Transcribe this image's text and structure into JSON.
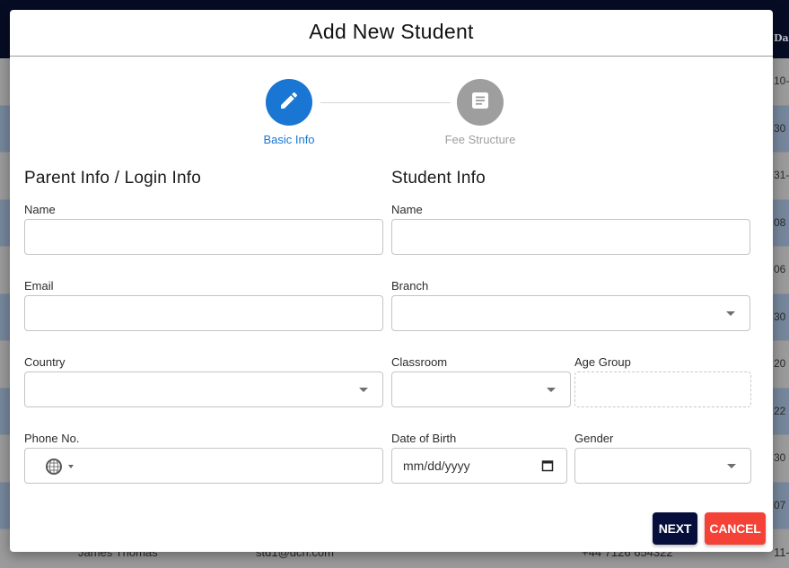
{
  "background": {
    "header_column": "Da",
    "row_dates": [
      "10-",
      "30",
      "31-",
      "08",
      "06",
      "30",
      "20",
      "22",
      "30",
      "07"
    ],
    "last_row": {
      "name": "James Thomas",
      "email": "std1@dch.com",
      "phone": "+44 7126 654322",
      "date": "11-"
    },
    "colors": {
      "header": "#060c24",
      "row_odd": "#9b9b9b",
      "row_even": "#76879d"
    }
  },
  "modal": {
    "title": "Add New Student",
    "stepper": {
      "steps": [
        {
          "label": "Basic Info",
          "icon": "pencil-icon",
          "state": "active"
        },
        {
          "label": "Fee Structure",
          "icon": "document-icon",
          "state": "inactive"
        }
      ],
      "active_color": "#1976d2",
      "inactive_color": "#9e9e9e"
    },
    "parent_section": {
      "title": "Parent Info / Login Info",
      "fields": {
        "name": {
          "label": "Name",
          "value": ""
        },
        "email": {
          "label": "Email",
          "value": ""
        },
        "country": {
          "label": "Country",
          "value": ""
        },
        "phone": {
          "label": "Phone No.",
          "value": "",
          "country_icon": "globe-icon"
        }
      }
    },
    "student_section": {
      "title": "Student Info",
      "fields": {
        "name": {
          "label": "Name",
          "value": ""
        },
        "branch": {
          "label": "Branch",
          "value": ""
        },
        "classroom": {
          "label": "Classroom",
          "value": ""
        },
        "age_group": {
          "label": "Age Group",
          "value": ""
        },
        "dob": {
          "label": "Date of Birth",
          "placeholder": "mm/dd/yyyy"
        },
        "gender": {
          "label": "Gender",
          "value": ""
        }
      }
    },
    "buttons": {
      "next": "NEXT",
      "cancel": "CANCEL",
      "next_color": "#060f3b",
      "cancel_color": "#f44336"
    }
  }
}
